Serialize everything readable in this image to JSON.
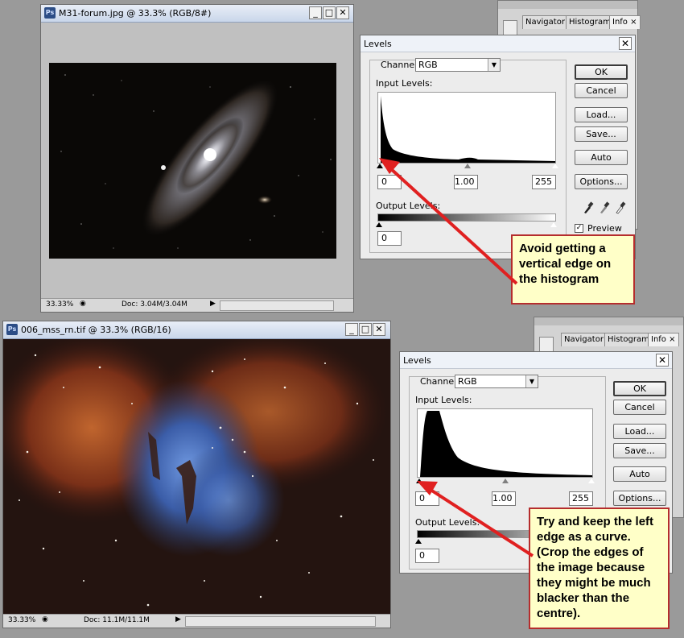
{
  "top": {
    "window": {
      "title": "M31-forum.jpg @ 33.3% (RGB/8#)",
      "ps_icon": "Ps",
      "zoom": "33.33%",
      "doc": "Doc: 3.04M/3.04M"
    },
    "panel_tabs": [
      "Navigator",
      "Histogram",
      "Info"
    ],
    "dialog": {
      "title": "Levels",
      "channel_label": "Channel:",
      "channel_value": "RGB",
      "input_levels_label": "Input Levels:",
      "input_black": "0",
      "input_gamma": "1.00",
      "input_white": "255",
      "output_levels_label": "Output Levels:",
      "output_black": "0",
      "buttons": {
        "ok": "OK",
        "cancel": "Cancel",
        "load": "Load...",
        "save": "Save...",
        "auto": "Auto",
        "options": "Options..."
      },
      "preview_label": "Preview"
    },
    "callout": "Avoid getting a vertical edge on the histogram"
  },
  "bottom": {
    "window": {
      "title": "006_mss_rn.tif @ 33.3% (RGB/16)",
      "ps_icon": "Ps",
      "zoom": "33.33%",
      "doc": "Doc: 11.1M/11.1M"
    },
    "panel_tabs": [
      "Navigator",
      "Histogram",
      "Info"
    ],
    "dialog": {
      "title": "Levels",
      "channel_label": "Channel:",
      "channel_value": "RGB",
      "input_levels_label": "Input Levels:",
      "input_black": "0",
      "input_gamma": "1.00",
      "input_white": "255",
      "output_levels_label": "Output Levels:",
      "output_black": "0",
      "buttons": {
        "ok": "OK",
        "cancel": "Cancel",
        "load": "Load...",
        "save": "Save...",
        "auto": "Auto",
        "options": "Options..."
      }
    },
    "callout": "Try and keep the left edge as a curve. (Crop the edges of the image because they might be much blacker than the centre)."
  },
  "colors": {
    "callout_border": "#b52d2d",
    "callout_bg": "#ffffc8",
    "arrow": "#e02020"
  }
}
